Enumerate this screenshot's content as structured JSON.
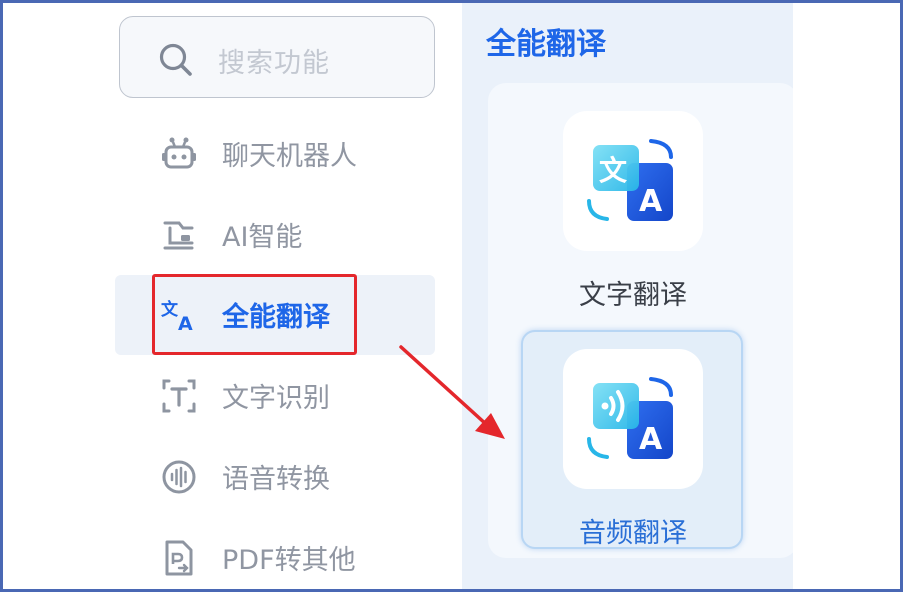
{
  "search": {
    "placeholder": "搜索功能"
  },
  "sidebar": {
    "items": [
      {
        "label": "聊天机器人",
        "icon": "robot-icon",
        "active": false
      },
      {
        "label": "AI智能",
        "icon": "ai-flow-icon",
        "active": false
      },
      {
        "label": "全能翻译",
        "icon": "translate-icon",
        "active": true
      },
      {
        "label": "文字识别",
        "icon": "text-scan-icon",
        "active": false
      },
      {
        "label": "语音转换",
        "icon": "audio-wave-icon",
        "active": false
      },
      {
        "label": "PDF转其他",
        "icon": "pdf-convert-icon",
        "active": false
      }
    ]
  },
  "panel": {
    "title": "全能翻译",
    "tools": [
      {
        "label": "文字翻译",
        "icon": "text-translate-icon",
        "selected": false
      },
      {
        "label": "音频翻译",
        "icon": "audio-translate-icon",
        "selected": true
      }
    ]
  },
  "colors": {
    "accent": "#1e66e8",
    "highlight": "#e4272c",
    "frame": "#4a68b4",
    "panel_bg": "#eaf1fa"
  }
}
